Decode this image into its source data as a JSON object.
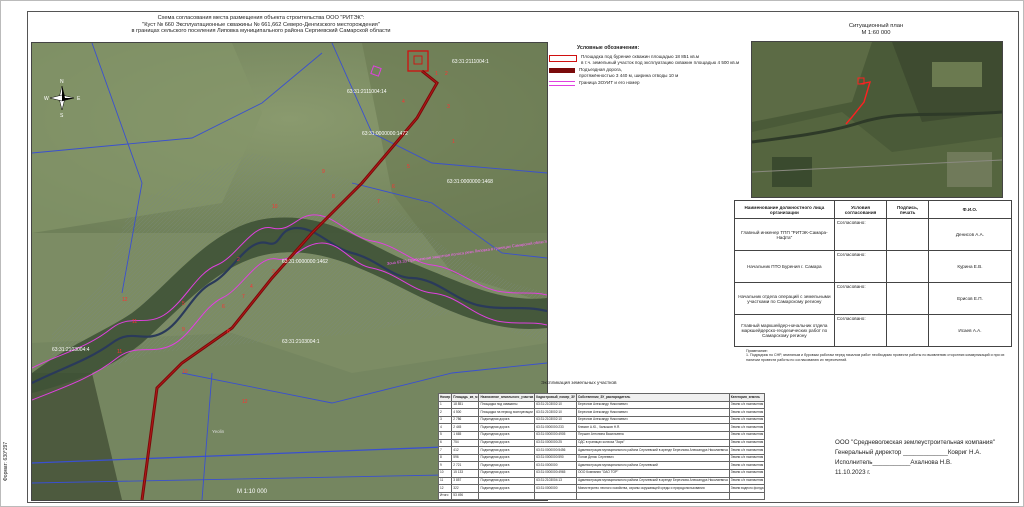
{
  "title": {
    "line1": "Схема согласования места размещения объекта строительства ООО \"РИТЭК\":",
    "line2": "\"Куст № 660 Эксплуатационные скважины № 661,662 Северо-Денгизского месторождения\"",
    "line3": "в границах сельского поселения Липовка муниципального района Сергиевский Самарской области"
  },
  "map": {
    "compass": {
      "n": "N",
      "s": "S",
      "w": "W",
      "e": "E"
    },
    "cadastral_labels": [
      "63:31:2111004:1",
      "63:31:2111004:14",
      "63:31:0000000:1472",
      "63:31:0000000:1468",
      "63:31:0000000:1462",
      "63:31:2103004:1",
      "63:31:2103004:4"
    ],
    "zouit_label": "Зона 63.33 Прибрежная защитная полоса реки Липовка в границах Самарской области",
    "numbers": [
      "1",
      "2",
      "3",
      "4",
      "5",
      "6",
      "7",
      "8",
      "9",
      "10",
      "11",
      "12",
      "1",
      "2",
      "3",
      "4",
      "5",
      "6",
      "7",
      "8",
      "9",
      "10",
      "11",
      "12"
    ],
    "scale": "М 1:10 000",
    "village": "Yeolin"
  },
  "legend": {
    "heading": "Условные обозначения:",
    "items": [
      {
        "color": "#d01010",
        "text": "Площадка под бурение скважин площадью 18 851 кв.м\nв т.ч. земельный участок под эксплуатацию скважин площадью 4 500 кв.м"
      },
      {
        "color": "#7a0a0a",
        "text": "Подъездная дорога,\nпротяжённостью 3 440 м, ширина отводы 10 м"
      },
      {
        "color": "#e040e0",
        "text": "Граница ЗОУИТ и его номер"
      }
    ]
  },
  "situation": {
    "title": "Ситуационный план",
    "scale": "М 1:60 000"
  },
  "agreement": {
    "headers": [
      "Наименование должностного лица организации",
      "Условия согласования",
      "Подпись, печать",
      "Ф.И.О."
    ],
    "rows": [
      {
        "position": "Главный инженер ТПП \"РИТЭК-Самара-Нафта\"",
        "status": "Согласовано:",
        "sign": "",
        "name": "Денисов А.А."
      },
      {
        "position": "Начальник ПТО Бурения г. Самара",
        "status": "Согласовано:",
        "sign": "",
        "name": "Курина Е.В."
      },
      {
        "position": "Начальник отдела операций с земельными участками по Самарскому региону",
        "status": "Согласовано:",
        "sign": "",
        "name": "Ерисов Е.П."
      },
      {
        "position": "Главный маркшейдер-начальник отдела маркшейдерско-геодезических работ по Самарскому региону",
        "status": "Согласовано:",
        "sign": "",
        "name": "Исаев А.А."
      }
    ]
  },
  "note": {
    "heading": "Примечание:",
    "text": "1. Подрядчик по СНР, земляным и буровым работам перед началом работ необходимо провести работы по выявлению сторонних коммуникаций и при их наличии провести работы по согласованию их пересечений."
  },
  "plots": {
    "title": "Экспликация земельных участков",
    "headers": [
      "Номер",
      "Площадь_кв_м",
      "Назначение_земельного_участка",
      "Кадастровый_номер_ЗУ",
      "Собственник_ЗУ_распорядитель",
      "Категория_земель"
    ],
    "rows": [
      [
        "1",
        "18 851",
        "Площадка под скважины",
        "63:31:2103002:10",
        "Березлов Александр Николаевич",
        "Земли с/х назначения"
      ],
      [
        "2",
        "4 500",
        "Площадка на период эксплуатации",
        "63:31:2103002:10",
        "Березлов Александр Николаевич",
        "Земли с/х назначения"
      ],
      [
        "3",
        "2 786",
        "Подъездная дорога",
        "63:31:2103002:10",
        "Березлов Александр Николаевич",
        "Земли с/х назначения"
      ],
      [
        "4",
        "2 445",
        "Подъездная дорога",
        "63:31:0000000:233",
        "Клюкин А.Ю., Чалышов Н.Я.",
        "Земли с/х назначения"
      ],
      [
        "5",
        "1 665",
        "Подъездная дорога",
        "63:31:0000000:4905",
        "Першин Антонина Васильевна",
        "Земли с/х назначения"
      ],
      [
        "6",
        "754",
        "Подъездная дорога",
        "63:31:0000000:25",
        "ОДС в границах колхоза \"Заря\"",
        "Земли с/х назначения"
      ],
      [
        "7",
        "412",
        "Подъездная дорога",
        "63:31:0000000:5456",
        "Администрация муниципального района Сергиевский в аренде Березлова Александра Николаевича",
        "Земли с/х назначения"
      ],
      [
        "8",
        "596",
        "Подъездная дорога",
        "63:31:0000000:590",
        "Попов Денис Сергеевич",
        "Земли с/х назначения"
      ],
      [
        "9",
        "2 721",
        "Подъездная дорога",
        "63:31:0000000",
        "Администрация муниципального района Сергиевский",
        "Земли с/х назначения"
      ],
      [
        "10",
        "15 133",
        "Подъездная дорога",
        "63:31:0000000:4965",
        "ООО Компания \"ОАО ТОР\"",
        "Земли с/х назначения"
      ],
      [
        "11",
        "3 857",
        "Подъездная дорога",
        "63:31:2103004:13",
        "Администрация муниципального района Сергиевский в аренде Березлова Александра Николаевича",
        "Земли с/х назначения"
      ],
      [
        "12",
        "322",
        "Подъездная дорога",
        "63:31:0000000",
        "Министерство лесного хозяйства, охраны окружающей среды и природопользования",
        "Земли водного фонда"
      ]
    ],
    "total_label": "Итого",
    "total_value": "53 496"
  },
  "company": {
    "name": "ООО \"Средневолжская землеустроительная компания\"",
    "director": "Генеральный директор _____________Ковриг Н.А.",
    "executor": "Исполнитель___________Ахалнова Н.В.",
    "date": "11.10.2023 г."
  },
  "format": "Формат: 630*297"
}
